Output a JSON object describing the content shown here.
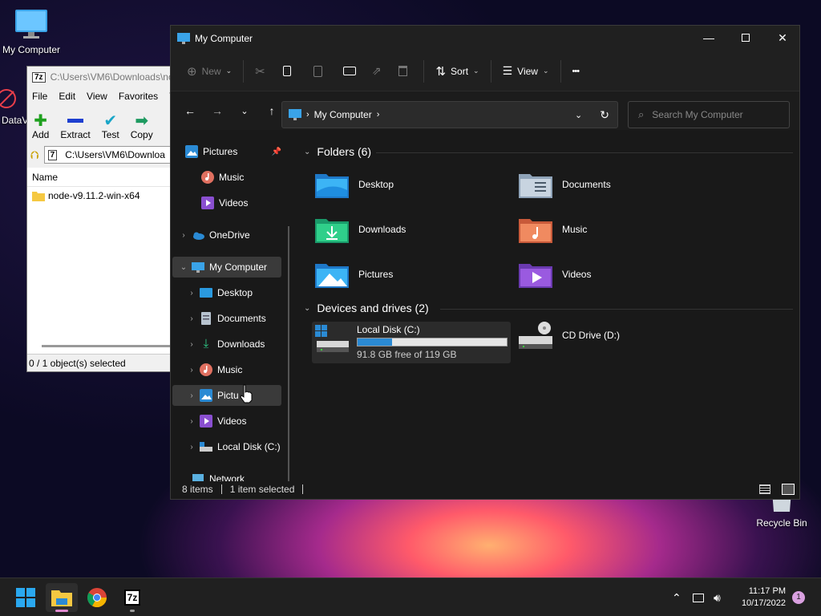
{
  "desktop": {
    "my_computer_label": "My Computer",
    "datav_label": "DataV",
    "recycle_bin_label": "Recycle Bin"
  },
  "sevenzip": {
    "title": "C:\\Users\\VM6\\Downloads\\no",
    "logo": "7z",
    "menu": [
      "File",
      "Edit",
      "View",
      "Favorites",
      "T"
    ],
    "tools": [
      "Add",
      "Extract",
      "Test",
      "Copy"
    ],
    "address": "C:\\Users\\VM6\\Downloa",
    "column_name": "Name",
    "file": "node-v9.11.2-win-x64",
    "status": "0 / 1 object(s) selected"
  },
  "explorer": {
    "title": "My Computer",
    "cmd": {
      "new": "New",
      "sort": "Sort",
      "view": "View",
      "more": "•••"
    },
    "address_path": "My Computer",
    "search_placeholder": "Search My Computer",
    "nav": {
      "pictures_quick": "Pictures",
      "music_quick": "Music",
      "videos_quick": "Videos",
      "onedrive": "OneDrive",
      "my_computer": "My Computer",
      "desktop": "Desktop",
      "documents": "Documents",
      "downloads": "Downloads",
      "music": "Music",
      "pictures": "Pictu",
      "videos": "Videos",
      "local_disk": "Local Disk (C:)",
      "network": "Network"
    },
    "folders_header": "Folders (6)",
    "folders": [
      "Desktop",
      "Documents",
      "Downloads",
      "Music",
      "Pictures",
      "Videos"
    ],
    "drives_header": "Devices and drives (2)",
    "local_disk": {
      "name": "Local Disk (C:)",
      "free": "91.8 GB free of 119 GB",
      "used_fraction": 0.23
    },
    "cd_drive": {
      "name": "CD Drive (D:)"
    },
    "status": {
      "items": "8 items",
      "selected": "1 item selected"
    }
  },
  "taskbar": {
    "time": "11:17 PM",
    "date": "10/17/2022",
    "notifications": "1",
    "sevenzip_label": "7z"
  },
  "colors": {
    "accent": "#2a8ad4",
    "selection": "#3a3a3a"
  }
}
